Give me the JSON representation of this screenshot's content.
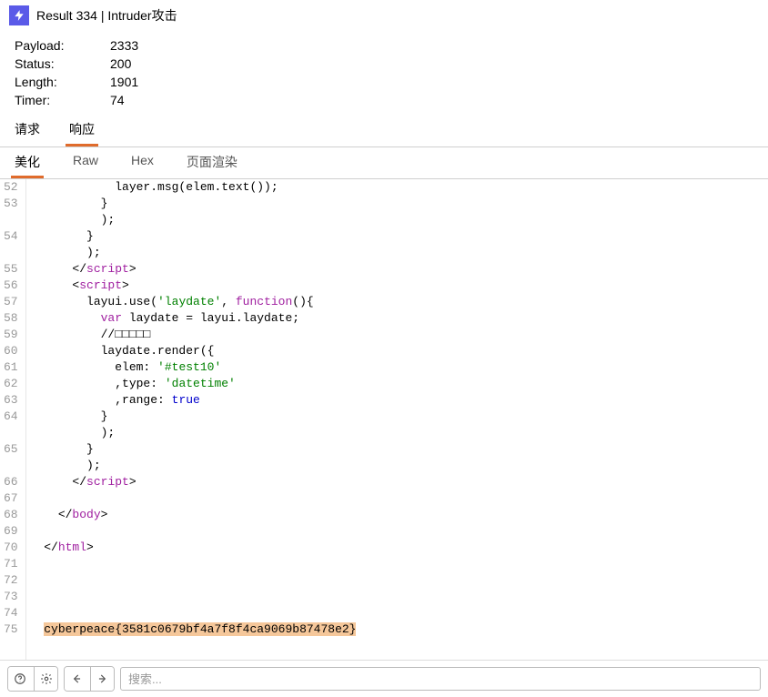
{
  "window": {
    "title": "Result 334 | Intruder攻击"
  },
  "info": {
    "payload_label": "Payload:",
    "payload_value": "2333",
    "status_label": "Status:",
    "status_value": "200",
    "length_label": "Length:",
    "length_value": "1901",
    "timer_label": "Timer:",
    "timer_value": "74"
  },
  "tabs1": {
    "request": "请求",
    "response": "响应"
  },
  "tabs2": {
    "pretty": "美化",
    "raw": "Raw",
    "hex": "Hex",
    "render": "页面渲染"
  },
  "code": {
    "lines": [
      {
        "n": 52,
        "seg": [
          {
            "t": "            layer.msg(elem.text());"
          }
        ]
      },
      {
        "n": 53,
        "seg": [
          {
            "t": "          }"
          }
        ]
      },
      {
        "n": null,
        "seg": [
          {
            "t": "          );"
          }
        ]
      },
      {
        "n": 54,
        "seg": [
          {
            "t": "        }"
          }
        ]
      },
      {
        "n": null,
        "seg": [
          {
            "t": "        );"
          }
        ]
      },
      {
        "n": 55,
        "seg": [
          {
            "t": "      </"
          },
          {
            "t": "script",
            "c": "t-tag"
          },
          {
            "t": ">"
          }
        ]
      },
      {
        "n": 56,
        "seg": [
          {
            "t": "      <"
          },
          {
            "t": "script",
            "c": "t-tag"
          },
          {
            "t": ">"
          }
        ]
      },
      {
        "n": 57,
        "seg": [
          {
            "t": "        layui.use("
          },
          {
            "t": "'laydate'",
            "c": "t-str"
          },
          {
            "t": ", "
          },
          {
            "t": "function",
            "c": "t-key"
          },
          {
            "t": "(){"
          }
        ]
      },
      {
        "n": 58,
        "seg": [
          {
            "t": "          "
          },
          {
            "t": "var",
            "c": "t-key"
          },
          {
            "t": " laydate = layui.laydate;"
          }
        ]
      },
      {
        "n": 59,
        "seg": [
          {
            "t": "          //□□□□□"
          }
        ]
      },
      {
        "n": 60,
        "seg": [
          {
            "t": "          laydate.render({"
          }
        ]
      },
      {
        "n": 61,
        "seg": [
          {
            "t": "            elem: "
          },
          {
            "t": "'#test10'",
            "c": "t-str"
          }
        ]
      },
      {
        "n": 62,
        "seg": [
          {
            "t": "            ,type: "
          },
          {
            "t": "'datetime'",
            "c": "t-str"
          }
        ]
      },
      {
        "n": 63,
        "seg": [
          {
            "t": "            ,range: "
          },
          {
            "t": "true",
            "c": "t-bool"
          }
        ]
      },
      {
        "n": 64,
        "seg": [
          {
            "t": "          }"
          }
        ]
      },
      {
        "n": null,
        "seg": [
          {
            "t": "          );"
          }
        ]
      },
      {
        "n": 65,
        "seg": [
          {
            "t": "        }"
          }
        ]
      },
      {
        "n": null,
        "seg": [
          {
            "t": "        );"
          }
        ]
      },
      {
        "n": 66,
        "seg": [
          {
            "t": "      </"
          },
          {
            "t": "script",
            "c": "t-tag"
          },
          {
            "t": ">"
          }
        ]
      },
      {
        "n": 67,
        "seg": [
          {
            "t": ""
          }
        ]
      },
      {
        "n": 68,
        "seg": [
          {
            "t": "    </"
          },
          {
            "t": "body",
            "c": "t-tag"
          },
          {
            "t": ">"
          }
        ]
      },
      {
        "n": 69,
        "seg": [
          {
            "t": ""
          }
        ]
      },
      {
        "n": 70,
        "seg": [
          {
            "t": "  </"
          },
          {
            "t": "html",
            "c": "t-tag"
          },
          {
            "t": ">"
          }
        ]
      },
      {
        "n": 71,
        "seg": [
          {
            "t": ""
          }
        ]
      },
      {
        "n": 72,
        "seg": [
          {
            "t": ""
          }
        ]
      },
      {
        "n": 73,
        "seg": [
          {
            "t": ""
          }
        ]
      },
      {
        "n": 74,
        "seg": [
          {
            "t": ""
          }
        ]
      },
      {
        "n": 75,
        "seg": [
          {
            "t": "  "
          },
          {
            "t": "cyberpeace{3581c0679bf4a7f8f4ca9069b87478e2}",
            "c": "hl"
          }
        ]
      }
    ]
  },
  "footer": {
    "search_placeholder": "搜索..."
  }
}
